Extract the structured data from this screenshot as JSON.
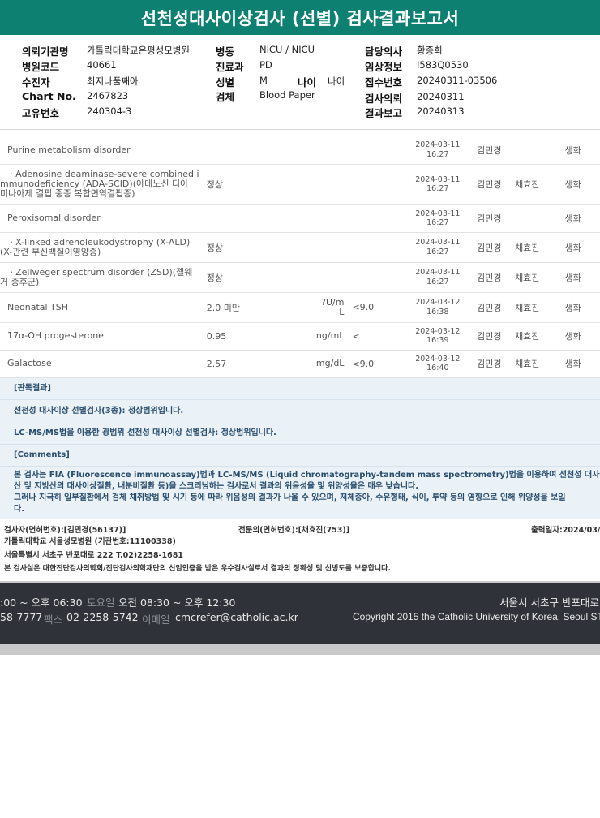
{
  "report_title": "선천성대사이상검사 (선별) 검사결과보고서",
  "header_info": {
    "requester_label": "의뢰기관명",
    "requester_value": "가톨릭대학교은평성모병원",
    "code_label": "병원코드",
    "code_value": "40661",
    "collector_label": "수진자",
    "collector_value": "최지나풀째아",
    "chart_label": "Chart No.",
    "chart_value": "2467823",
    "unique_label": "고유번호",
    "unique_value": "240304-3",
    "ward_label": "병동",
    "ward_value": "NICU / NICU",
    "dept_label": "진료과",
    "dept_value": "PD",
    "sex_label": "성별",
    "sex_value": "M",
    "age_label": "나이",
    "age_value": "나이",
    "specimen_label": "검체",
    "specimen_value": "Blood Paper",
    "doctor_label": "담당의사",
    "doctor_value": "황종희",
    "clinical_label": "임상정보",
    "clinical_value": "I583Q0530",
    "reception_label": "접수번호",
    "reception_value": "20240311-03506",
    "request_label": "검사의뢰",
    "request_value": "20240311",
    "report_label": "결과보고",
    "report_value": "20240313"
  },
  "results": [
    {
      "name_lines": [
        "Purine metabolism disorder"
      ],
      "value": "",
      "unit": "",
      "ref": "",
      "date": "2024-03-11",
      "time": "16:27",
      "verifier1": "김민경",
      "verifier2": "",
      "dept": "생화"
    },
    {
      "name_lines": [
        "ㆍAdenosine deaminase-severe combined i",
        "mmunodeficiency (ADA-SCID)(아데노신 디아",
        "미나아제 결핍 중증 복합면역결핍증)"
      ],
      "value": "정상",
      "unit": "",
      "ref": "",
      "date": "2024-03-11",
      "time": "16:27",
      "verifier1": "김민경",
      "verifier2": "채효진",
      "dept": "생화"
    },
    {
      "name_lines": [
        "Peroxisomal disorder"
      ],
      "value": "",
      "unit": "",
      "ref": "",
      "date": "2024-03-11",
      "time": "16:27",
      "verifier1": "김민경",
      "verifier2": "",
      "dept": "생화"
    },
    {
      "name_lines": [
        "ㆍX-linked adrenoleukodystrophy (X-ALD)",
        "(X-관련 부신백질이영양증)"
      ],
      "value": "정상",
      "unit": "",
      "ref": "",
      "date": "2024-03-11",
      "time": "16:27",
      "verifier1": "김민경",
      "verifier2": "채효진",
      "dept": "생화"
    },
    {
      "name_lines": [
        "ㆍZellweger spectrum disorder (ZSD)(젤웨",
        "거 증후군)"
      ],
      "value": "정상",
      "unit": "",
      "ref": "",
      "date": "2024-03-11",
      "time": "16:27",
      "verifier1": "김민경",
      "verifier2": "채효진",
      "dept": "생화"
    },
    {
      "name_lines": [
        "Neonatal TSH"
      ],
      "value": "2.0 미만",
      "unit": "?U/m\nL",
      "ref": "<9.0",
      "date": "2024-03-12",
      "time": "16:38",
      "verifier1": "김민경",
      "verifier2": "채효진",
      "dept": "생화"
    },
    {
      "name_lines": [
        "17α-OH progesterone"
      ],
      "value": "0.95",
      "unit": "ng/mL",
      "ref": "<",
      "date": "2024-03-12",
      "time": "16:39",
      "verifier1": "김민경",
      "verifier2": "채효진",
      "dept": "생화"
    },
    {
      "name_lines": [
        "Galactose"
      ],
      "value": "2.57",
      "unit": "mg/dL",
      "ref": "<9.0",
      "date": "2024-03-12",
      "time": "16:40",
      "verifier1": "김민경",
      "verifier2": "채효진",
      "dept": "생화"
    }
  ],
  "interpretation": {
    "heading": "[판독결과]",
    "line1": "선천성 대사이상 선별검사(3종): 정상범위입니다.",
    "line2": "LC-MS/MS법을 이용한 광범위 선천성 대사이상 선별검사: 정상범위입니다."
  },
  "comments": {
    "heading": "[Comments]",
    "line1": "본 검사는 FIA (Fluorescence immunoassay)법과 LC-MS/MS (Liquid chromatography-tandem mass spectrometry)법을 이용하여 선천성 대사이상질환(아",
    "line2": "산 및 지방산의 대사이상질환, 내분비질환 등)을 스크리닝하는 검사로서 결과의 위음성율 및 위양성율은 매우 낮습니다.",
    "line3": "그러나 지극히 일부질환에서 검체 채취방법 및 시기 등에 따라 위음성의 결과가 나올 수 있으며, 저체중아, 수유형태, 식이, 투약 등의 영향으로 인해 위양성을 보일",
    "line4": "다."
  },
  "report_footer": {
    "tester": "검사자(면허번호):[김민경(56137)]",
    "specialist": "전문의(면허번호):[채효진(753)]",
    "print_date": "출력일자:2024/03/",
    "institution": "가톨릭대학교 서울성모병원 (기관번호:11100338)",
    "address": "서울특별시 서초구 반포대로 222 T.02)2258-1681",
    "certification": "본 검사실은 대한진단검사의학회/진단검사의학재단의 신임인증을 받은 우수검사실로서 결과의 정확성 및 신빙도를 보증합니다."
  },
  "site_footer": {
    "weekday_hours": ":00 ~ 오후 06:30",
    "sat_label": "토요일",
    "sat_hours": "오전 08:30 ~ 오후 12:30",
    "phone": "58-7777",
    "fax_label": "팩스",
    "fax": "02-2258-5742",
    "email_label": "이메일",
    "email": "cmcrefer@catholic.ac.kr",
    "address": "서울시 서초구 반포대로",
    "copyright": "Copyright 2015 the Catholic University of Korea, Seoul ST."
  }
}
